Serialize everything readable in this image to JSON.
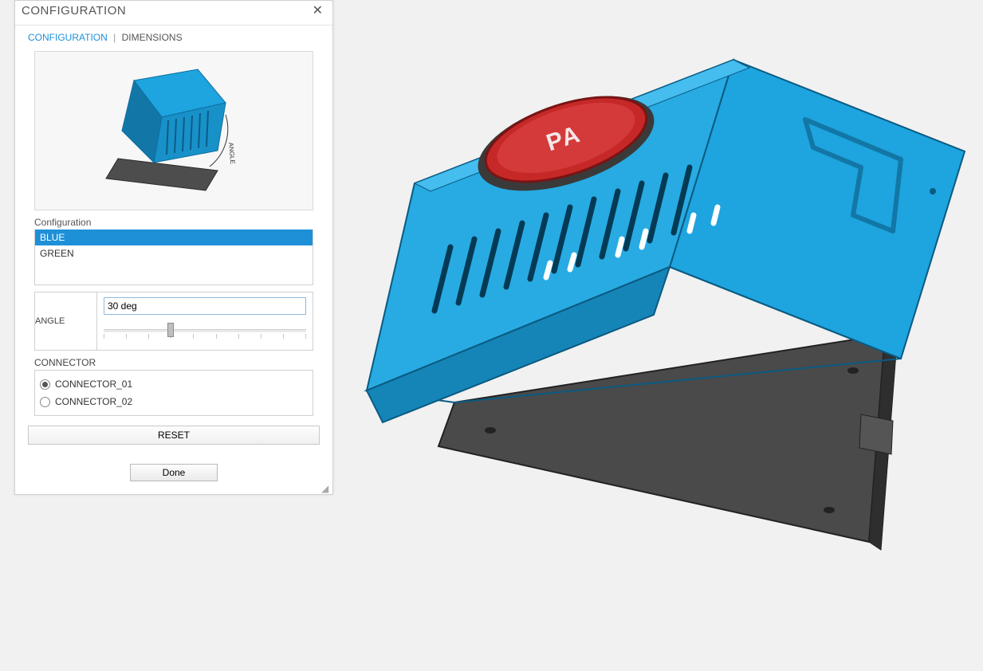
{
  "panel": {
    "title": "CONFIGURATION",
    "tabs": {
      "config": "CONFIGURATION",
      "dims": "DIMENSIONS",
      "active": "config"
    }
  },
  "configuration": {
    "label": "Configuration",
    "options": [
      "BLUE",
      "GREEN"
    ],
    "selected": "BLUE"
  },
  "angle": {
    "label": "ANGLE",
    "value": "30 deg",
    "min": 0,
    "max": 90,
    "current": 30
  },
  "connector": {
    "label": "CONNECTOR",
    "options": [
      "CONNECTOR_01",
      "CONNECTOR_02"
    ],
    "selected": "CONNECTOR_01"
  },
  "buttons": {
    "reset": "RESET",
    "done": "Done"
  },
  "colors": {
    "accent": "#1e90d8",
    "body_blue": "#1ea4de",
    "base_gray": "#4a4a4a",
    "emblem_red": "#c62828"
  }
}
